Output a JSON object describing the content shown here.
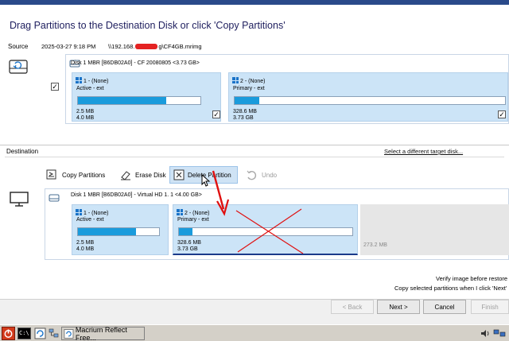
{
  "colors": {
    "accent": "#1a9bdc",
    "partition_bg": "#cce4f7",
    "arrow": "#e01010",
    "title": "#1e1e5e"
  },
  "header": {
    "title": "Drag Partitions to the Destination Disk or click 'Copy Partitions'"
  },
  "source": {
    "label": "Source",
    "timestamp": "2025-03-27 9:18 PM",
    "path_prefix": "\\\\192.168.",
    "path_suffix": "g\\CF4GB.mrimg",
    "disk_header": "Disk 1 MBR [B6DB02A0] - CF 20080805  <3.73 GB>",
    "partitions": [
      {
        "name": "1 -  (None)",
        "type": "Active - ext",
        "used": "2.5 MB",
        "size": "4.0 MB",
        "fill": 0.72,
        "checked": "✓"
      },
      {
        "name": "2 -  (None)",
        "type": "Primary - ext",
        "used": "328.6 MB",
        "size": "3.73 GB",
        "fill": 0.09,
        "checked": "✓"
      }
    ],
    "disk_checked": "✓"
  },
  "destination": {
    "label": "Destination",
    "select_link": "Select a different target disk...",
    "toolbar": {
      "copy_partitions": "Copy Partitions",
      "erase_disk": "Erase Disk",
      "delete_partition": "Delete Partition",
      "undo": "Undo"
    },
    "disk_header": "Disk 1 MBR [B6DB02A0] - Virtual HD 1. 1  <4.00 GB>",
    "partitions": [
      {
        "name": "1 -  (None)",
        "type": "Active - ext",
        "used": "2.5 MB",
        "size": "4.0 MB",
        "fill": 0.72
      },
      {
        "name": "2 -  (None)",
        "type": "Primary - ext",
        "used": "328.6 MB",
        "size": "3.73 GB",
        "fill": 0.08
      }
    ],
    "unallocated": "273.2 MB",
    "verify_text": "Verify image before restore",
    "copy_text": "Copy selected partitions when I click 'Next'"
  },
  "footer": {
    "back": "< Back",
    "next": "Next >",
    "cancel": "Cancel",
    "finish": "Finish"
  },
  "taskbar": {
    "app": "Macrium Reflect Free..."
  }
}
